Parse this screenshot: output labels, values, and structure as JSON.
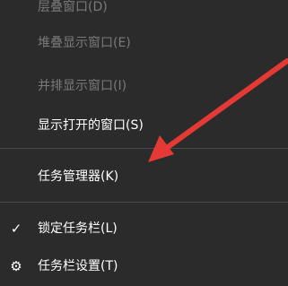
{
  "menu": {
    "items": [
      {
        "label": "层叠窗口(D)",
        "disabled": true
      },
      {
        "label": "堆叠显示窗口(E)",
        "disabled": true
      },
      {
        "label": "并排显示窗口(I)",
        "disabled": true
      },
      {
        "label": "显示打开的窗口(S)",
        "disabled": false
      },
      {
        "label": "任务管理器(K)",
        "disabled": false
      },
      {
        "label": "锁定任务栏(L)",
        "disabled": false,
        "checked": true
      },
      {
        "label": "任务栏设置(T)",
        "disabled": false,
        "icon": "gear-icon"
      }
    ],
    "check_glyph": "✓",
    "gear_glyph": "⚙"
  },
  "colors": {
    "background": "#2b2b2b",
    "text": "#ffffff",
    "disabled_text": "#7a7a7a",
    "separator": "#4a4a4a",
    "annotation_arrow": "#e53935"
  }
}
